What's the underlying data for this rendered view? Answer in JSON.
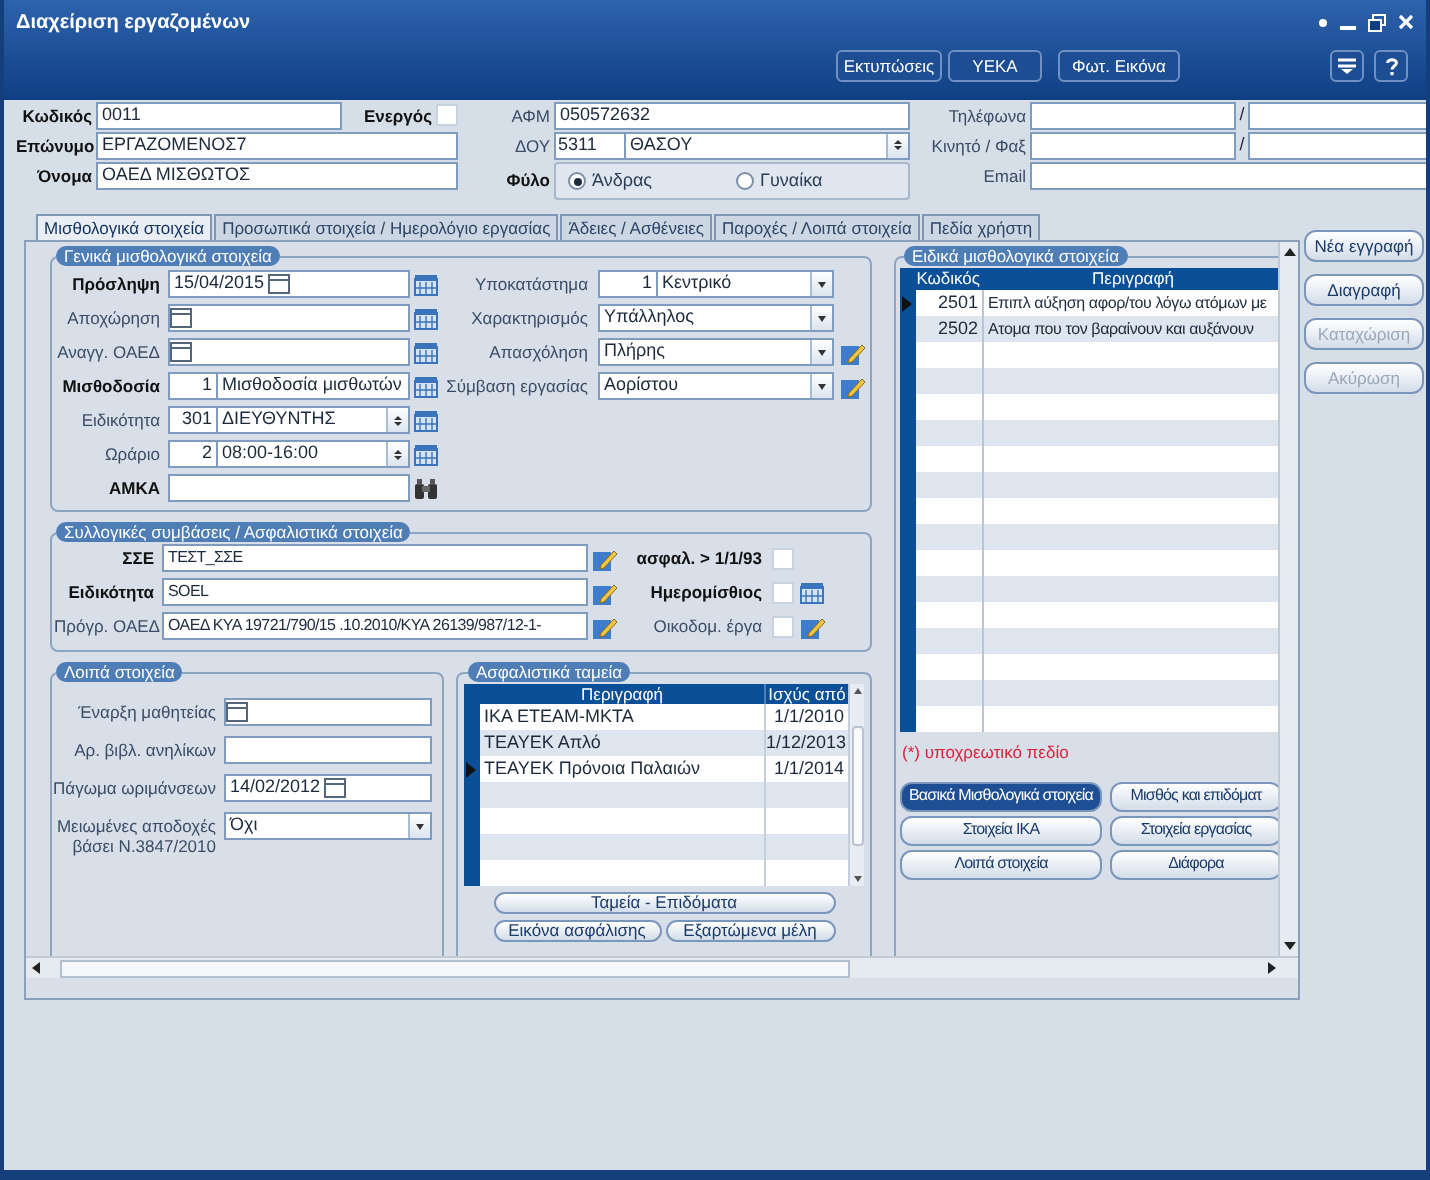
{
  "window": {
    "title": "Διαχείριση εργαζομένων"
  },
  "toolbar": {
    "buttons": [
      "Εκτυπώσεις",
      "ΥΕΚΑ",
      "Φωτ. Εικόνα"
    ]
  },
  "header": {
    "code": {
      "label": "Κωδικός",
      "value": "0011",
      "required": true
    },
    "active": {
      "label": "Ενεργός",
      "required": true,
      "checked": false
    },
    "surname": {
      "label": "Επώνυμο",
      "value": "ΕΡΓΑΖΟΜΕΝΟΣ7",
      "required": true
    },
    "first_name": {
      "label": "Όνομα",
      "value": "ΟΑΕΔ ΜΙΣΘΩΤΟΣ",
      "required": true
    },
    "afm": {
      "label": "ΑΦΜ",
      "value": "050572632",
      "required": false
    },
    "doy": {
      "label": "ΔΟΥ",
      "code": "5311",
      "value": "ΘΑΣΟΥ",
      "required": false
    },
    "gender": {
      "label": "Φύλο",
      "required": true,
      "options": [
        {
          "label": "Άνδρας",
          "selected": true
        },
        {
          "label": "Γυναίκα",
          "selected": false
        }
      ]
    },
    "phone": {
      "label": "Τηλέφωνα",
      "separator": "/"
    },
    "mobile": {
      "label": "Κινητό / Φαξ",
      "separator": "/"
    },
    "email": {
      "label": "Email"
    }
  },
  "tabs": [
    {
      "label": "Μισθολογικά στοιχεία",
      "selected": true
    },
    {
      "label": "Προσωπικά στοιχεία / Ημερολόγιο εργασίας",
      "selected": false
    },
    {
      "label": "Άδειες / Ασθένειες",
      "selected": false
    },
    {
      "label": "Παροχές / Λοιπά στοιχεία",
      "selected": false
    },
    {
      "label": "Πεδία χρήστη",
      "selected": false
    }
  ],
  "side_buttons": [
    {
      "label": "Νέα εγγραφή",
      "disabled": false
    },
    {
      "label": "Διαγραφή",
      "disabled": false
    },
    {
      "label": "Καταχώριση",
      "disabled": true
    },
    {
      "label": "Ακύρωση",
      "disabled": true
    }
  ],
  "general": {
    "title": "Γενικά μισθολογικά στοιχεία",
    "left_fields": [
      {
        "kind": "date",
        "label": "Πρόσληψη",
        "required": true,
        "value": "15/04/2015"
      },
      {
        "kind": "date",
        "label": "Αποχώρηση",
        "required": false
      },
      {
        "kind": "date",
        "label": "Αναγγ. ΟΑΕΔ",
        "required": false
      },
      {
        "kind": "lookup",
        "label": "Μισθοδοσία",
        "required": true,
        "code": "1",
        "value": "Μισθοδοσία μισθωτών"
      },
      {
        "kind": "spin",
        "label": "Ειδικότητα",
        "required": false,
        "code": "301",
        "value": "ΔΙΕΥΘΥΝΤΗΣ"
      },
      {
        "kind": "spin",
        "label": "Ωράριο",
        "required": false,
        "code": "2",
        "value": "08:00-16:00"
      },
      {
        "kind": "search",
        "label": "ΑΜΚΑ",
        "required": true
      }
    ],
    "right_fields": [
      {
        "kind": "code_dropdown",
        "label": "Υποκατάστημα",
        "required": false,
        "code": "1",
        "value": "Κεντρικό"
      },
      {
        "kind": "dropdown",
        "label": "Χαρακτηρισμός",
        "required": false,
        "value": "Υπάλληλος"
      },
      {
        "kind": "dropdown_edit",
        "label": "Απασχόληση",
        "required": false,
        "value": "Πλήρης"
      },
      {
        "kind": "dropdown_edit",
        "label": "Σύμβαση εργασίας",
        "required": false,
        "value": "Αορίστου"
      }
    ]
  },
  "contracts": {
    "title": "Συλλογικές συμβάσεις / Ασφαλιστικά στοιχεία",
    "fields": [
      {
        "kind": "edit",
        "label": "ΣΣΕ",
        "required": true,
        "value": "ΤΕΣΤ_ΣΣΕ"
      },
      {
        "kind": "edit",
        "label": "Ειδικότητα",
        "required": true,
        "value": "SOEL"
      },
      {
        "kind": "edit",
        "label": "Πρόγρ. ΟΑΕΔ",
        "required": false,
        "value": "ΟΑΕΔ ΚΥΑ 19721/790/15 .10.2010/ΚΥΑ 26139/987/12-1-"
      }
    ],
    "flags": [
      {
        "kind": "check",
        "label": "ασφαλ. > 1/1/93",
        "required": true,
        "checked": false
      },
      {
        "kind": "check_calendar",
        "label": "Ημερομίσθιος",
        "required": true,
        "checked": false
      },
      {
        "kind": "check_edit",
        "label": "Οικοδομ. έργα",
        "required": false,
        "checked": false
      }
    ]
  },
  "other": {
    "title": "Λοιπά στοιχεία",
    "fields": [
      {
        "kind": "date_plain",
        "label": "Έναρξη μαθητείας",
        "required": false
      },
      {
        "kind": "text",
        "label": "Αρ. βιβλ. ανηλίκων",
        "required": false
      },
      {
        "kind": "date_plain",
        "label": "Πάγωμα ωριμάνσεων",
        "required": false,
        "value": "14/02/2012"
      },
      {
        "kind": "dropdown",
        "label": "Μειωμένες αποδοχές βάσει Ν.3847/2010",
        "required": false,
        "value": "Όχι"
      }
    ]
  },
  "funds": {
    "title": "Ασφαλιστικά ταμεία",
    "columns": [
      "Περιγραφή",
      "Ισχύς από"
    ],
    "rows": [
      {
        "cells": [
          "ΙΚΑ ΕΤΕΑΜ-ΜΚΤΑ",
          "1/1/2010"
        ],
        "selected": false
      },
      {
        "cells": [
          "ΤΕΑΥΕΚ Απλό",
          "1/12/2013"
        ],
        "selected": false
      },
      {
        "cells": [
          "ΤΕΑΥΕΚ Πρόνοια Παλαιών",
          "1/1/2014"
        ],
        "selected": true
      }
    ],
    "buttons": [
      "Ταμεία - Επιδόματα",
      "Εικόνα ασφάλισης",
      "Εξαρτώμενα μέλη"
    ]
  },
  "special": {
    "title": "Ειδικά μισθολογικά στοιχεία",
    "columns": [
      "Κωδικός",
      "Περιγραφή"
    ],
    "rows": [
      {
        "cells": [
          "2501",
          "Επιπλ αύξηση αφορ/του λόγω ατόμων με"
        ],
        "selected": true
      },
      {
        "cells": [
          "2502",
          "Ατομα που τον βαραίνουν και αυξάνουν"
        ],
        "selected": false
      }
    ],
    "note": "(*) υποχρεωτικό πεδίο",
    "sections": [
      {
        "label": "Βασικά Μισθολογικά στοιχεία",
        "selected": true
      },
      {
        "label": "Μισθός και επιδόματ",
        "selected": false
      },
      {
        "label": "Στοιχεία ΙΚΑ",
        "selected": false
      },
      {
        "label": "Στοιχεία εργασίας",
        "selected": false
      },
      {
        "label": "Λοιπά στοιχεία",
        "selected": false
      },
      {
        "label": "Διάφορα",
        "selected": false
      }
    ]
  }
}
